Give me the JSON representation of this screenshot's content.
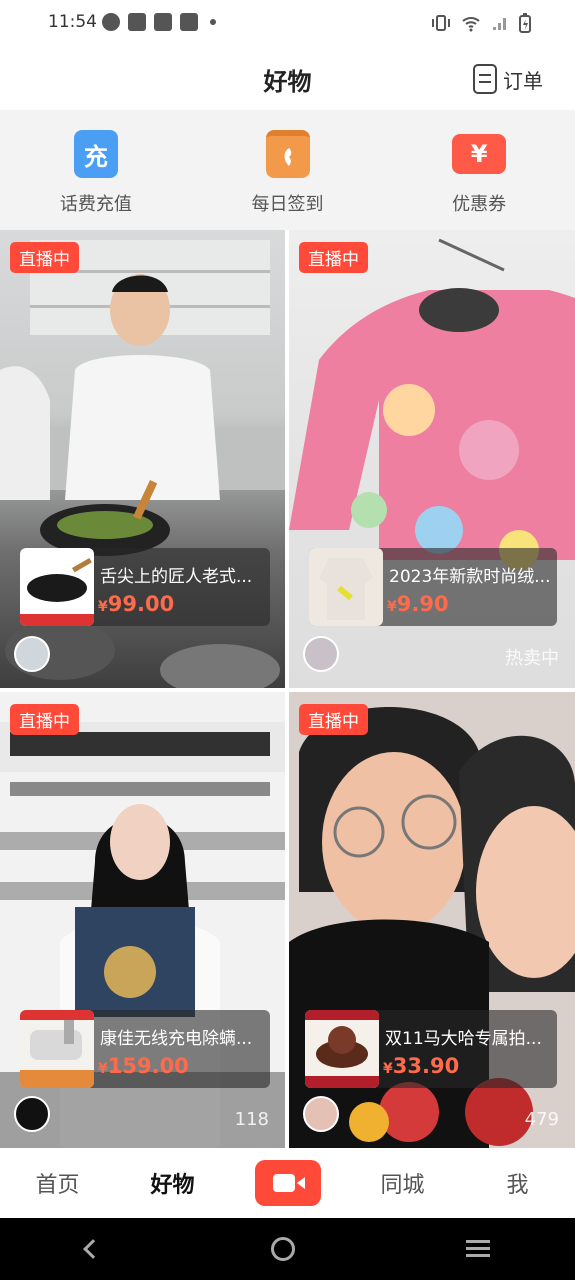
{
  "status": {
    "time": "11:54"
  },
  "header": {
    "title": "好物",
    "order_label": "订单"
  },
  "quick": [
    {
      "label": "话费充值",
      "icon": "recharge-icon",
      "glyph": "充",
      "color": "#4a9ff5"
    },
    {
      "label": "每日签到",
      "icon": "calendar-icon",
      "glyph": "",
      "color": "#f39a4a"
    },
    {
      "label": "优惠券",
      "icon": "coupon-icon",
      "glyph": "¥",
      "color": "#ff5a48"
    }
  ],
  "cards": [
    {
      "badge": "直播中",
      "name": "舌尖上的匠人老式...",
      "currency": "¥",
      "price": "99.00",
      "footer": ""
    },
    {
      "badge": "直播中",
      "name": "2023年新款时尚绒...",
      "currency": "¥",
      "price": "9.90",
      "footer": "热卖中"
    },
    {
      "badge": "直播中",
      "name": "康佳无线充电除螨...",
      "currency": "¥",
      "price": "159.00",
      "footer": "118"
    },
    {
      "badge": "直播中",
      "name": "双11马大哈专属拍...",
      "currency": "¥",
      "price": "33.90",
      "footer": "479"
    }
  ],
  "tabs": {
    "home": "首页",
    "goods": "好物",
    "city": "同城",
    "me": "我"
  }
}
